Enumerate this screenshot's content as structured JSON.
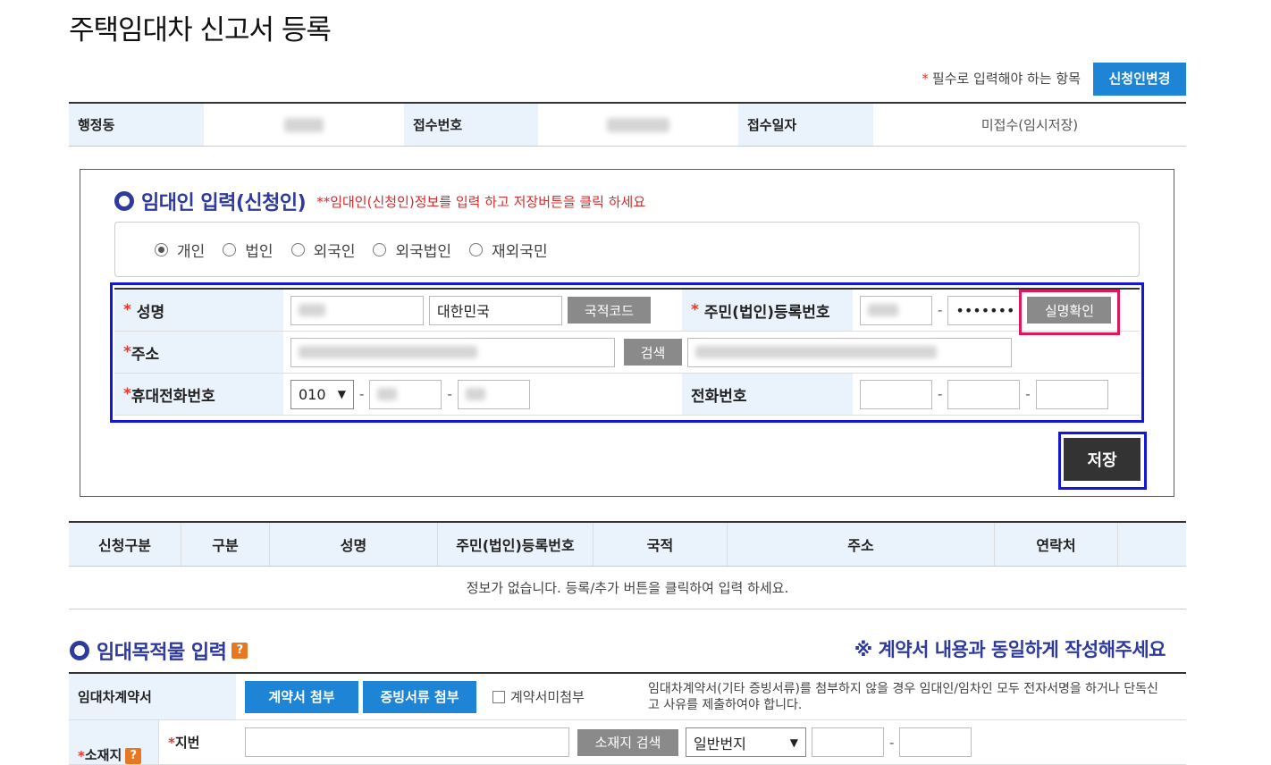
{
  "page": {
    "title": "주택임대차 신고서 등록"
  },
  "header": {
    "required_note": "필수로 입력해야 하는 항목",
    "required_star": "*",
    "change_button": "신청인변경"
  },
  "info_table": {
    "labels": [
      "행정동",
      "접수번호",
      "접수일자"
    ],
    "receipt_date_value": "미접수(임시저장)"
  },
  "lessor_section": {
    "title": "임대인 입력(신청인)",
    "hint": "**임대인(신청인)정보를 입력 하고 저장버튼을 클릭 하세요",
    "types": [
      {
        "label": "개인",
        "checked": true
      },
      {
        "label": "법인",
        "checked": false
      },
      {
        "label": "외국인",
        "checked": false
      },
      {
        "label": "외국법인",
        "checked": false
      },
      {
        "label": "재외국민",
        "checked": false
      }
    ],
    "name_label": "성명",
    "nationality_value": "대한민국",
    "nationality_code_button": "국적코드",
    "rrn_label": "주민(법인)등록번호",
    "rrn_masked": "•••••••",
    "verify_button": "실명확인",
    "address_label": "주소",
    "address_search_button": "검색",
    "mobile_label": "휴대전화번호",
    "mobile_prefix": "010",
    "phone_label": "전화번호",
    "dash": "-",
    "required_star": "*",
    "save_button": "저장"
  },
  "list_table": {
    "headers": [
      "신청구분",
      "구분",
      "성명",
      "주민(법인)등록번호",
      "국적",
      "주소",
      "연락처",
      ""
    ],
    "empty_message": "정보가 없습니다.  등록/추가 버튼을 클릭하여 입력 하세요."
  },
  "property_section": {
    "title": "임대목적물 입력",
    "help_badge": "?",
    "notice": "※ 계약서 내용과 동일하게 작성해주세요",
    "contract_label": "임대차계약서",
    "attach_contract_button": "계약서 첨부",
    "attach_evidence_button": "증빙서류 첨부",
    "no_contract_checkbox": "계약서미첨부",
    "contract_note": "임대차계약서(기타 증빙서류)를 첨부하지 않을 경우 임대인/임차인 모두 전자서명을 하거나 단독신고 사유를 제출하여야 합니다.",
    "location_label": "소재지",
    "lot_label": "지번",
    "location_search_button": "소재지 검색",
    "lot_type_value": "일반번지"
  },
  "colors": {
    "accent": "#1e85d6",
    "section_title": "#2f3a9e",
    "required": "#e8382b",
    "highlight_red": "#d62b2b",
    "highlight_blue": "#1418d6",
    "highlight_pink": "#e0185a"
  }
}
